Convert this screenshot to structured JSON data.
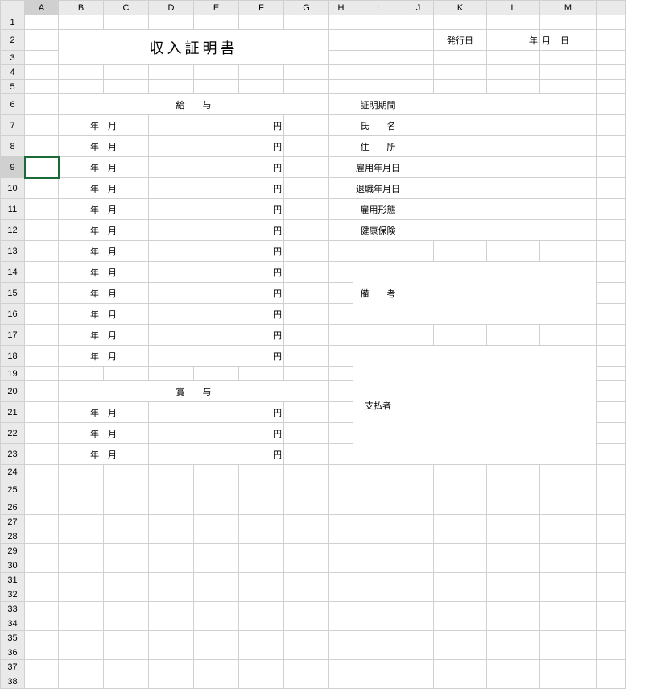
{
  "cols": [
    "A",
    "B",
    "C",
    "D",
    "E",
    "F",
    "G",
    "H",
    "I",
    "J",
    "K",
    "L",
    "M"
  ],
  "rows": [
    1,
    2,
    3,
    4,
    5,
    6,
    7,
    8,
    9,
    10,
    11,
    12,
    13,
    14,
    15,
    16,
    17,
    18,
    19,
    20,
    21,
    22,
    23,
    24,
    25,
    26,
    27,
    28,
    29,
    30,
    31,
    32,
    33,
    34,
    35,
    36,
    37,
    38
  ],
  "title": "収入証明書",
  "issue_label": "発行日",
  "date_y": "年",
  "date_m": "月",
  "date_d": "日",
  "salary_header": "給　　与",
  "bonus_header": "賞　　与",
  "ym_year": "年",
  "ym_month": "月",
  "yen": "円",
  "labels": {
    "period": "証明期間",
    "name": "氏　　名",
    "address": "住　　所",
    "hire_date": "雇用年月日",
    "leave_date": "退職年月日",
    "emp_type": "雇用形態",
    "insurance": "健康保険",
    "remarks": "備　　考",
    "payer": "支払者"
  },
  "selected_cell": "A9"
}
